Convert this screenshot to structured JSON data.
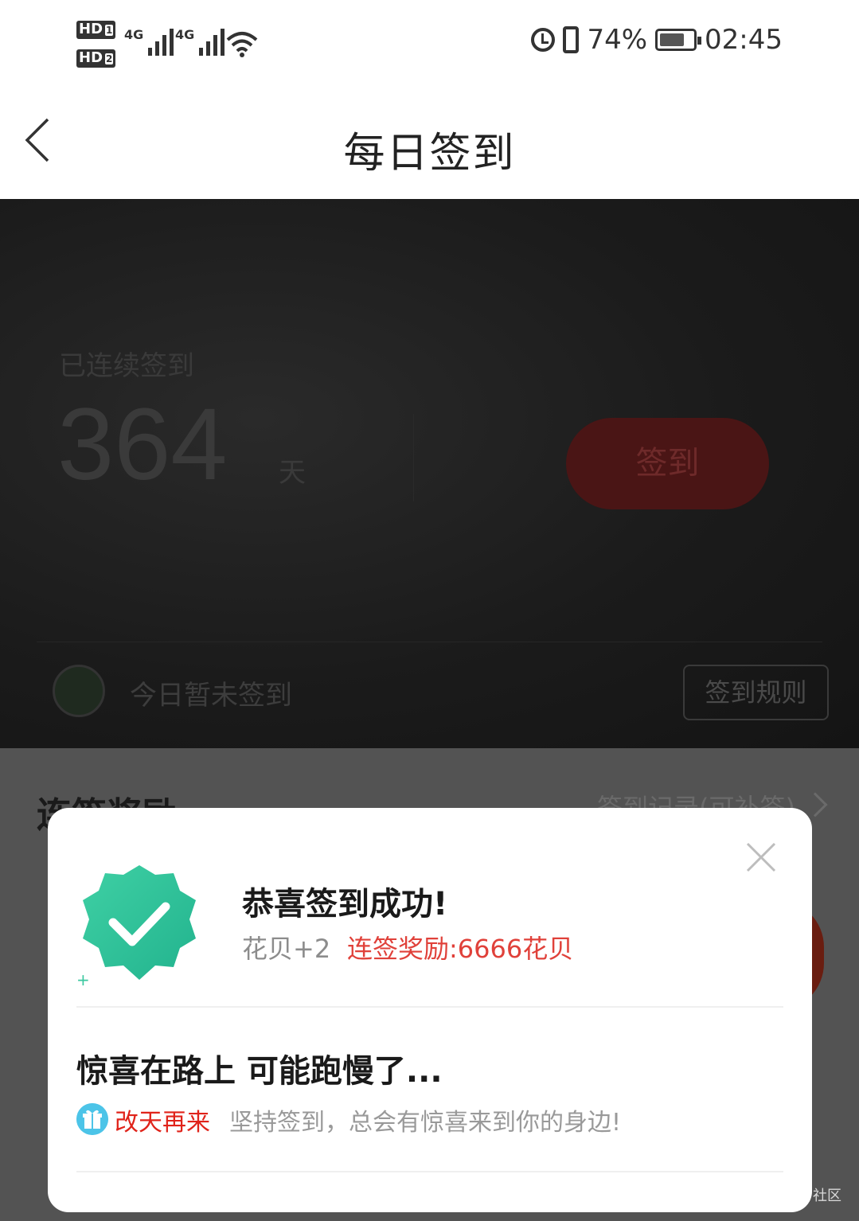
{
  "status_bar": {
    "hd1": "HD",
    "hd1_sub": "1",
    "hd2": "HD",
    "hd2_sub": "2",
    "network1": "4G",
    "network2": "4G",
    "battery_percent": "74%",
    "time": "02:45"
  },
  "nav": {
    "title": "每日签到",
    "back_icon": "chevron-left-icon"
  },
  "hero": {
    "streak_label": "已连续签到",
    "streak_count": "364",
    "streak_unit": "天",
    "sign_button": "签到",
    "today_status": "今日暂未签到",
    "rules_button": "签到规则"
  },
  "rewards": {
    "title": "连签奖励",
    "history_link": "签到记录(可补签)"
  },
  "modal": {
    "title": "恭喜签到成功!",
    "coins": "花贝+2",
    "bonus": "连签奖励:6666花贝",
    "surprise_title": "惊喜在路上 可能跑慢了...",
    "come_back": "改天再来",
    "encourage": "坚持签到，总会有惊喜来到你的身边!",
    "badge_icon": "check-badge-icon",
    "gift_icon": "gift-icon",
    "close_icon": "close-icon"
  },
  "watermark": "社区",
  "colors": {
    "accent_red": "#e0413a",
    "badge_green": "#2fc59a",
    "gift_blue": "#4cc4e8"
  }
}
